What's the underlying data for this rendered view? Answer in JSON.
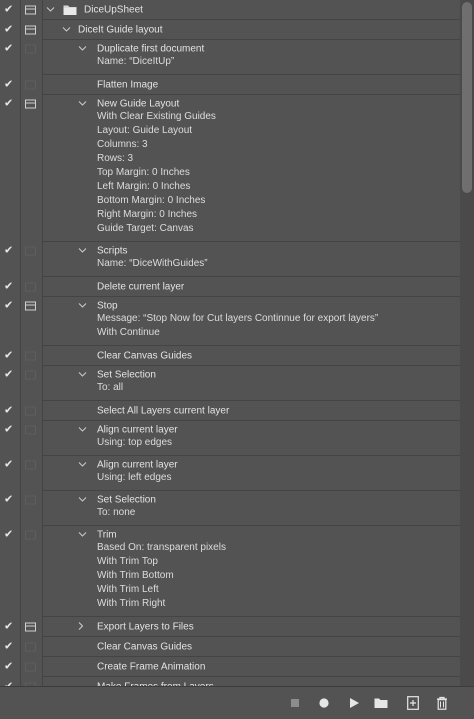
{
  "rows": [
    {
      "type": "action",
      "label": "DiceUpSheet",
      "check": true,
      "dialog": "on",
      "level": 0,
      "expand": "open",
      "folder": true,
      "h": 20
    },
    {
      "type": "action",
      "label": "DiceIt Guide layout",
      "check": true,
      "dialog": "on",
      "level": 1,
      "expand": "open",
      "h": 20
    },
    {
      "type": "action",
      "label": "Duplicate first document",
      "check": true,
      "dialog": "off",
      "level": 2,
      "expand": "open",
      "h": 17,
      "details": [
        "Name:  “DiceItUp”"
      ]
    },
    {
      "type": "action",
      "label": "Flatten Image",
      "check": true,
      "dialog": "off",
      "level": 2,
      "expand": "none",
      "h": 20
    },
    {
      "type": "action",
      "label": "New Guide Layout",
      "check": true,
      "dialog": "on",
      "level": 2,
      "expand": "open",
      "h": 17,
      "details": [
        "With Clear Existing Guides",
        "Layout: Guide Layout",
        "Columns: 3",
        "Rows: 3",
        "Top Margin: 0 Inches",
        "Left Margin: 0 Inches",
        "Bottom Margin: 0 Inches",
        "Right Margin: 0 Inches",
        "Guide Target: Canvas"
      ]
    },
    {
      "type": "action",
      "label": "Scripts",
      "check": true,
      "dialog": "off",
      "level": 2,
      "expand": "open",
      "h": 17,
      "details": [
        "Name:  “DiceWithGuides”"
      ]
    },
    {
      "type": "action",
      "label": "Delete current layer",
      "check": true,
      "dialog": "off",
      "level": 2,
      "expand": "none",
      "h": 20
    },
    {
      "type": "action",
      "label": "Stop",
      "check": true,
      "dialog": "on",
      "level": 2,
      "expand": "open",
      "h": 17,
      "details": [
        "Message:  “Stop Now for Cut layers Continnue for export layers”",
        "With Continue"
      ]
    },
    {
      "type": "action",
      "label": "Clear Canvas Guides",
      "check": true,
      "dialog": "off",
      "level": 2,
      "expand": "none",
      "h": 20
    },
    {
      "type": "action",
      "label": "Set Selection",
      "check": true,
      "dialog": "off",
      "level": 2,
      "expand": "open",
      "h": 17,
      "details": [
        "To: all"
      ]
    },
    {
      "type": "action",
      "label": "Select All Layers current layer",
      "check": true,
      "dialog": "off",
      "level": 2,
      "expand": "none",
      "h": 20
    },
    {
      "type": "action",
      "label": "Align current layer",
      "check": true,
      "dialog": "off",
      "level": 2,
      "expand": "open",
      "h": 17,
      "details": [
        "Using: top edges"
      ]
    },
    {
      "type": "action",
      "label": "Align current layer",
      "check": true,
      "dialog": "off",
      "level": 2,
      "expand": "open",
      "h": 17,
      "details": [
        "Using: left edges"
      ]
    },
    {
      "type": "action",
      "label": "Set Selection",
      "check": true,
      "dialog": "off",
      "level": 2,
      "expand": "open",
      "h": 17,
      "details": [
        "To: none"
      ]
    },
    {
      "type": "action",
      "label": "Trim",
      "check": true,
      "dialog": "off",
      "level": 2,
      "expand": "open",
      "h": 17,
      "details": [
        "Based On: transparent pixels",
        "With Trim Top",
        "With Trim Bottom",
        "With Trim Left",
        "With Trim Right"
      ]
    },
    {
      "type": "action",
      "label": "Export Layers to Files",
      "check": true,
      "dialog": "on",
      "level": 2,
      "expand": "closed",
      "h": 20
    },
    {
      "type": "action",
      "label": "Clear Canvas Guides",
      "check": true,
      "dialog": "off",
      "level": 2,
      "expand": "none",
      "h": 20
    },
    {
      "type": "action",
      "label": "Create Frame Animation",
      "check": true,
      "dialog": "off",
      "level": 2,
      "expand": "none",
      "h": 20
    },
    {
      "type": "action",
      "label": "Make Frames from Layers",
      "check": true,
      "dialog": "off",
      "level": 2,
      "expand": "none",
      "h": 20
    }
  ],
  "scroll": {
    "thumb_start_fraction": 0.0,
    "thumb_size_fraction": 0.28
  },
  "footer": [
    {
      "name": "stop-playing-button",
      "icon": "stop-icon"
    },
    {
      "name": "record-button",
      "icon": "record-icon"
    },
    {
      "name": "play-button",
      "icon": "play-icon"
    },
    {
      "name": "new-set-button",
      "icon": "folder-icon"
    },
    {
      "name": "new-action-button",
      "icon": "new-icon"
    },
    {
      "name": "delete-button",
      "icon": "trash-icon"
    }
  ],
  "colors": {
    "panel_bg": "#535353",
    "separator": "#444444",
    "text": "#e3e3e3"
  }
}
